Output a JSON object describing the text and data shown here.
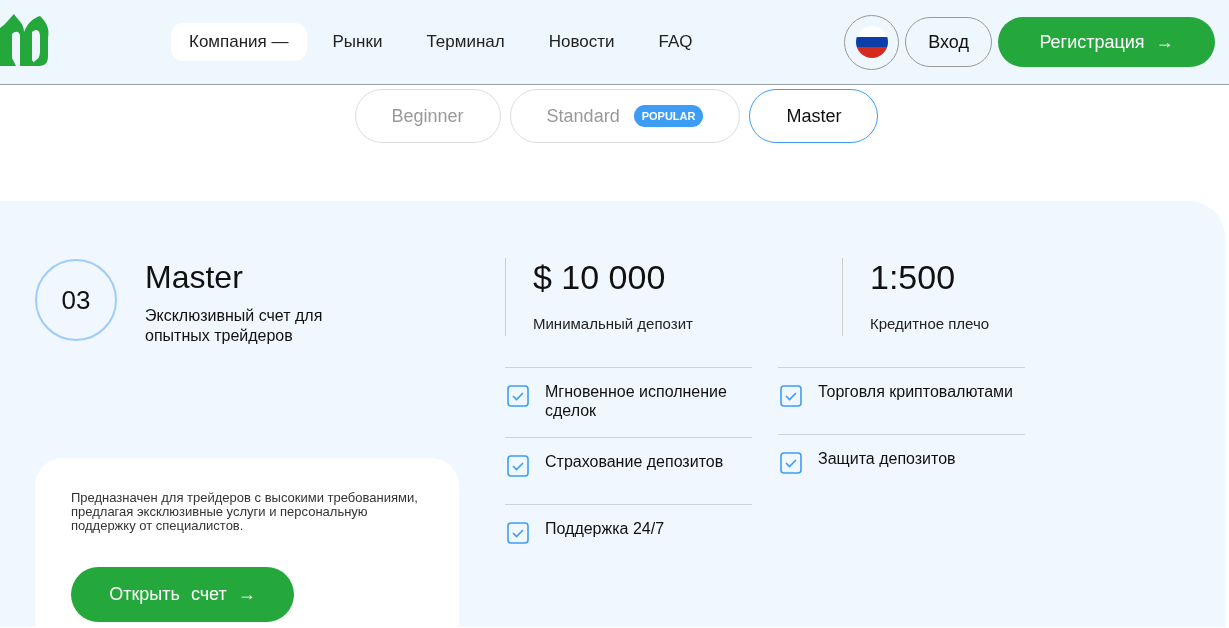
{
  "header": {
    "nav": [
      {
        "label": "Компания —",
        "selected": true
      },
      {
        "label": "Рынки",
        "selected": false
      },
      {
        "label": "Терминал",
        "selected": false
      },
      {
        "label": "Новости",
        "selected": false
      },
      {
        "label": "FAQ",
        "selected": false
      }
    ],
    "login": "Вход",
    "register": "Регистрация →"
  },
  "plan_tabs": [
    {
      "label": "Beginner",
      "selected": false
    },
    {
      "label": "Standard",
      "badge": "POPULAR",
      "selected": false
    },
    {
      "label": "Master",
      "selected": true
    }
  ],
  "plan": {
    "number": "03",
    "title": "Master",
    "subtitle": "Эксклюзивный счет для опытных трейдеров",
    "stats": [
      {
        "value": "$ 10 000",
        "label": "Минимальный депозит"
      },
      {
        "value": "1:500",
        "label": "Кредитное плечо"
      }
    ],
    "features": [
      [
        {
          "text": "Мгновенное исполнение сделок",
          "checked": true
        },
        {
          "text": "Страхование депозитов",
          "checked": true
        },
        {
          "text": "Поддержка 24/7",
          "checked": true
        }
      ],
      [
        {
          "text": "Торговля криптовалютами",
          "checked": true
        },
        {
          "text": "Защита депозитов",
          "checked": true
        }
      ]
    ],
    "description": "Предназначен для трейдеров с высокими требованиями, предлагая эксклюзивные услуги и персональную поддержку от специалистов.",
    "open_button": "Открыть счет →"
  }
}
